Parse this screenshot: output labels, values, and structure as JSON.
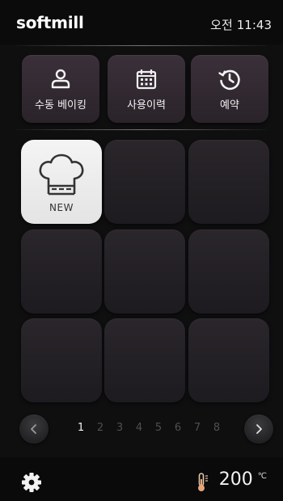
{
  "header": {
    "logo": "softmill",
    "ampm": "오전",
    "time": "11:43"
  },
  "actions": [
    {
      "label": "수동 베이킹",
      "icon": "person-icon"
    },
    {
      "label": "사용이력",
      "icon": "calendar-icon"
    },
    {
      "label": "예약",
      "icon": "history-clock-icon"
    }
  ],
  "grid": {
    "new_label": "NEW",
    "new_icon": "chef-hat-icon",
    "empty_tiles": 8
  },
  "pager": {
    "pages": [
      "1",
      "2",
      "3",
      "4",
      "5",
      "6",
      "7",
      "8"
    ],
    "current": "1",
    "prev_icon": "chevron-left-icon",
    "next_icon": "chevron-right-icon"
  },
  "footer": {
    "settings_icon": "gear-icon",
    "temperature": "200",
    "unit": "℃",
    "temp_icon": "thermometer-icon"
  },
  "colors": {
    "background": "#0f0f10",
    "action_button": "#3b303a",
    "tile": "#2a262b",
    "new_tile": "#f4f4f4",
    "active_page": "#f2f2f2",
    "inactive_page": "#4f4f52"
  }
}
